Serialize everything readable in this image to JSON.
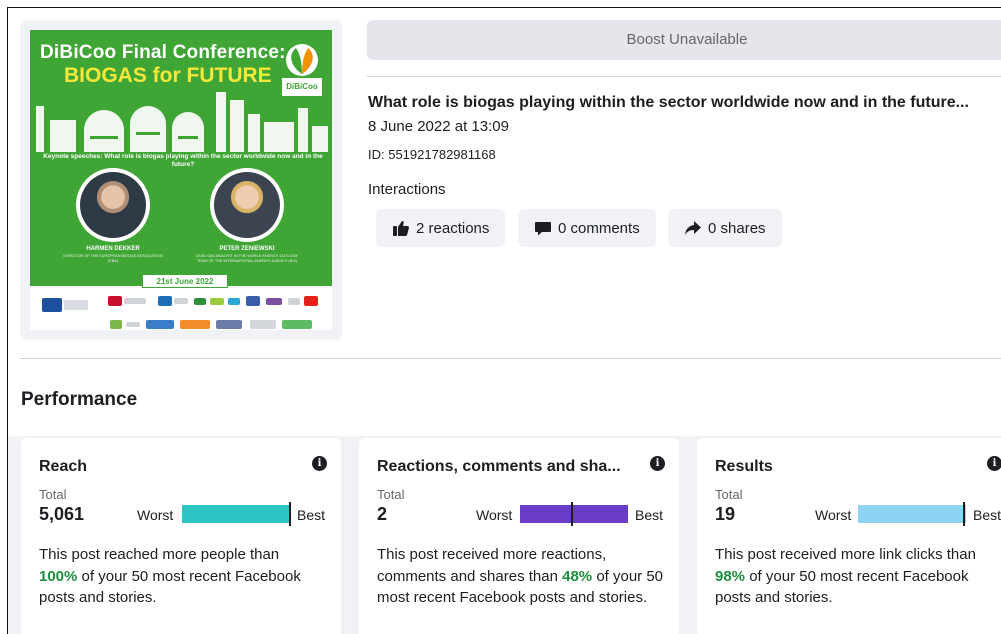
{
  "poster": {
    "title_line1": "DiBiCoo Final Conference:",
    "title_line2": "BIOGAS for FUTURE",
    "logo_text": "DiBiCoo",
    "keynote": "Keynote speeches: What role is biogas playing within the sector worldwide now and in the future?",
    "speaker1_name": "HARMEN DEKKER",
    "speaker1_role": "DIRECTOR OF THE EUROPEAN BIOGAS ASSOCIATION (EBA)",
    "speaker2_name": "PETER ZENIEWSKI",
    "speaker2_role": "LEAD GAS ANALYST IN THE WORLD ENERGY OUTLOOK TEAM OF THE INTERNATIONAL ENERGY AGENCY (IEA)",
    "date": "21st June 2022",
    "brand_color": "#3fa535"
  },
  "boost_label": "Boost Unavailable",
  "post": {
    "title": "What role is biogas playing within the sector worldwide now and in the future...",
    "date": "8 June 2022 at 13:09",
    "id": "ID: 551921782981168"
  },
  "interactions": {
    "label": "Interactions",
    "reactions": "2 reactions",
    "comments": "0 comments",
    "shares": "0 shares"
  },
  "performance_heading": "Performance",
  "cards": [
    {
      "title": "Reach",
      "total_label": "Total",
      "total": "5,061",
      "worst": "Worst",
      "best": "Best",
      "bar_color": "#2ec4c4",
      "percentile": 1.0,
      "desc_pre": "This post reached more people than",
      "desc_pct": "100%",
      "desc_post": "of your 50 most recent Facebook posts and stories."
    },
    {
      "title": "Reactions, comments and sha...",
      "total_label": "Total",
      "total": "2",
      "worst": "Worst",
      "best": "Best",
      "bar_color": "#6a3cc8",
      "percentile": 0.48,
      "desc_pre": "This post received more reactions, comments and shares than",
      "desc_pct": "48%",
      "desc_post": "of your 50 most recent Facebook posts and stories."
    },
    {
      "title": "Results",
      "total_label": "Total",
      "total": "19",
      "worst": "Worst",
      "best": "Best",
      "bar_color": "#8fd3f4",
      "percentile": 0.98,
      "desc_pre": "This post received more link clicks than",
      "desc_pct": "98%",
      "desc_post": "of your 50 most recent Facebook posts and stories."
    }
  ]
}
